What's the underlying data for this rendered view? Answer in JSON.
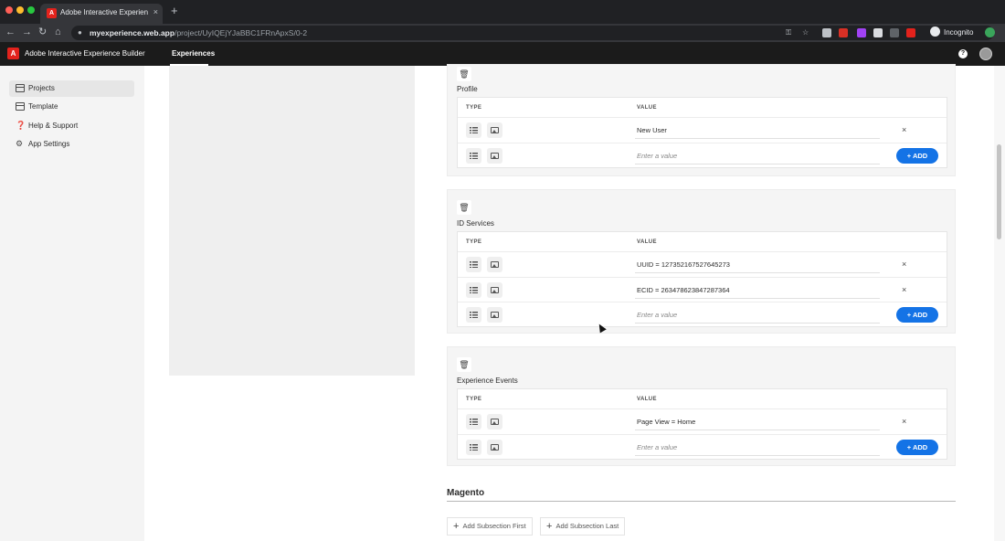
{
  "browser": {
    "tab_title": "Adobe Interactive Experience B",
    "tab_close": "×",
    "new_tab": "+",
    "url_host": "myexperience.web.app",
    "url_path": "/project/UyIQEjYJaBBC1FRnApxS/0-2",
    "incognito_label": "Incognito"
  },
  "app": {
    "logo_glyph": "A",
    "name": "Adobe Interactive Experience Builder",
    "nav_active": "Experiences",
    "help_glyph": "?"
  },
  "sidebar": {
    "items": [
      {
        "label": "Projects",
        "icon": "projects-icon",
        "active": true
      },
      {
        "label": "Template",
        "icon": "template-icon",
        "active": false
      },
      {
        "label": "Help & Support",
        "icon": "help-icon",
        "active": false
      },
      {
        "label": "App Settings",
        "icon": "gear-icon",
        "active": false
      }
    ]
  },
  "table_headers": {
    "type": "TYPE",
    "value": "VALUE"
  },
  "sections": [
    {
      "title": "Profile",
      "rows": [
        {
          "value": "New User"
        }
      ],
      "new_row_placeholder": "Enter a value"
    },
    {
      "title": "ID Services",
      "rows": [
        {
          "value": "UUID = 127352167527645273"
        },
        {
          "value": "ECID = 263478623847287364"
        }
      ],
      "new_row_placeholder": "Enter a value"
    },
    {
      "title": "Experience Events",
      "rows": [
        {
          "value": "Page View = Home"
        }
      ],
      "new_row_placeholder": "Enter a value"
    }
  ],
  "buttons": {
    "add_label": "+ ADD",
    "remove_glyph": "×",
    "trash_glyph": "🗑"
  },
  "magento": {
    "title": "Magento",
    "add_first": "Add Subsection First",
    "add_last": "Add Subsection Last"
  },
  "colors": {
    "accent": "#1473e6",
    "brand_red": "#e3221c",
    "header_bg": "#1b1b1b"
  }
}
